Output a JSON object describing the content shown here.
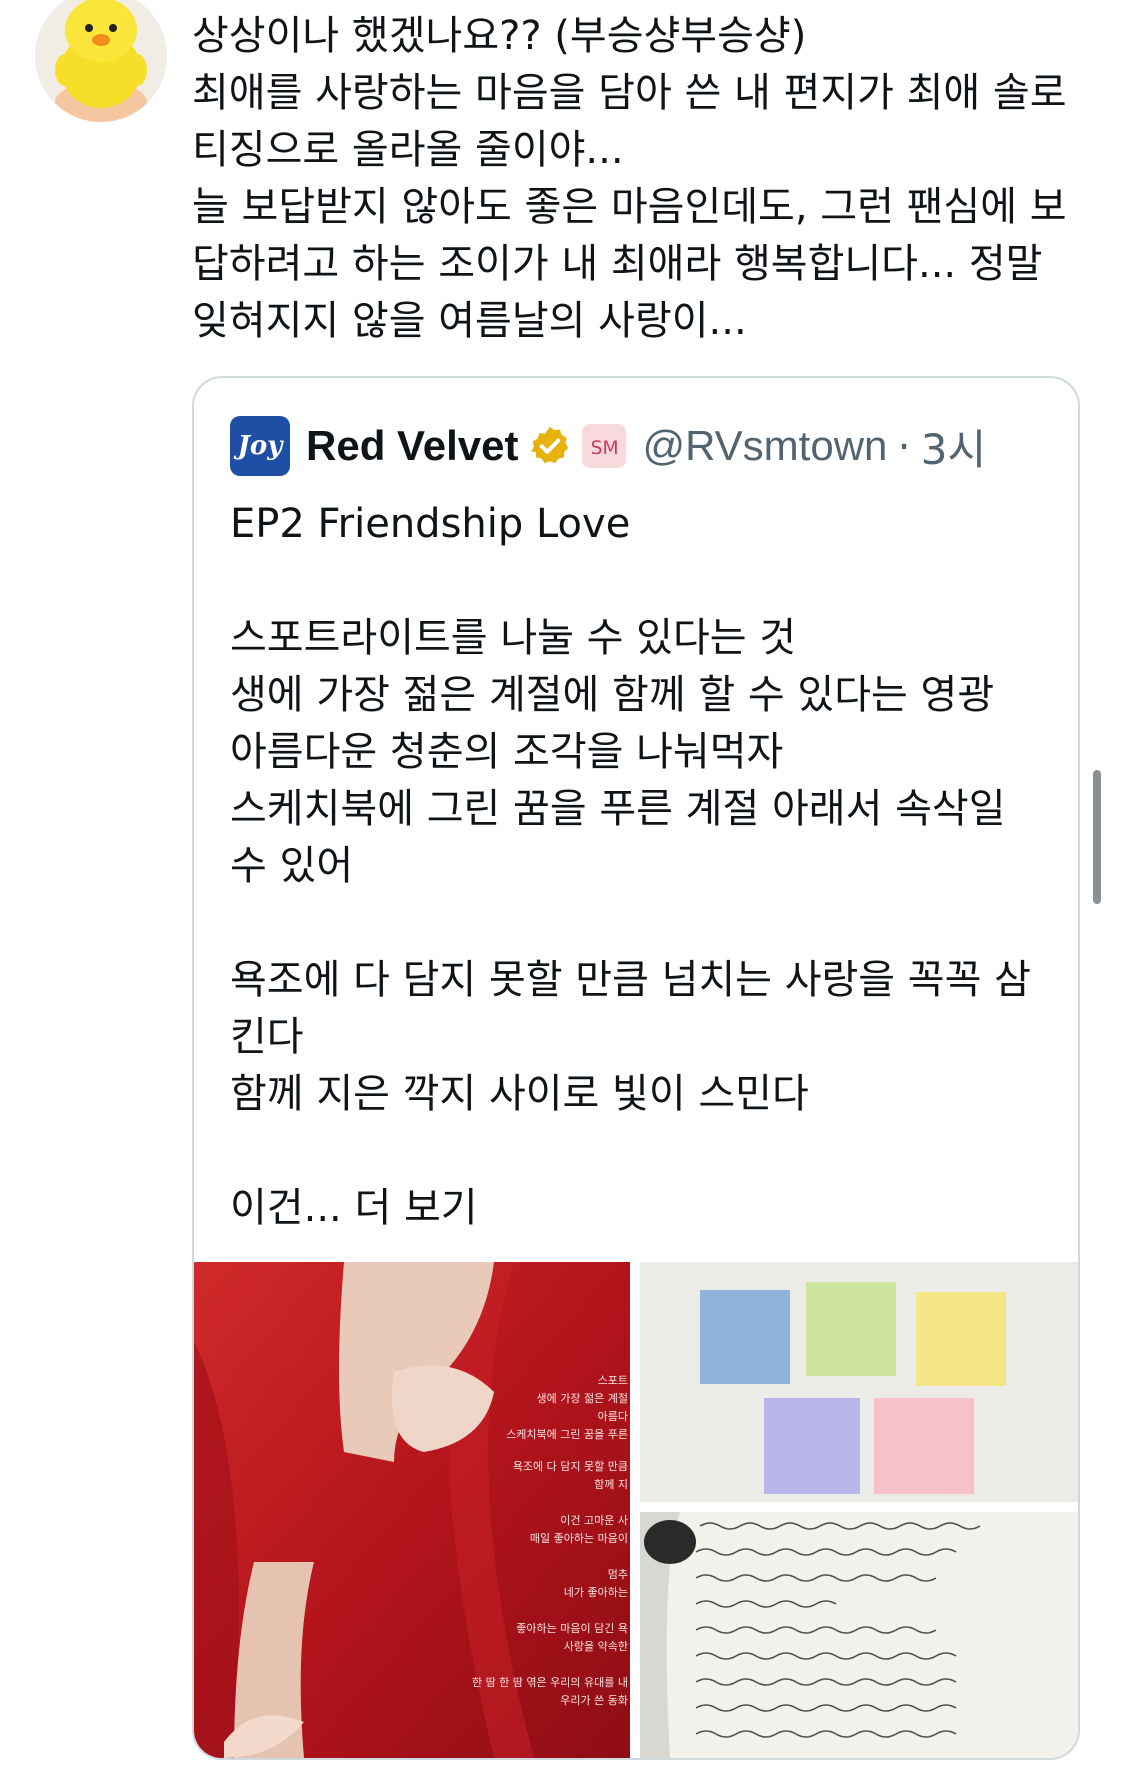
{
  "tweet": {
    "text": "상상이나 했겠나요?? (부승샹부승샹)\n최애를 사랑하는 마음을 담아 쓴 내 편지가 최애 솔로 티징으로 올라올 줄이야...\n늘 보답받지 않아도 좋은 마음인데도, 그런 팬심에 보답하려고 하는 조이가 내 최애라 행복합니다... 정말 잊혀지지 않을 여름날의 사랑이..."
  },
  "quote": {
    "avatar_text": "Joy",
    "name": "Red Velvet",
    "handle": "@RVsmtown",
    "dot": "·",
    "time": "3시",
    "body": "EP2 Friendship Love\n\n스포트라이트를 나눌 수 있다는 것\n생에 가장 젊은 계절에 함께 할 수 있다는 영광\n아름다운 청춘의 조각을 나눠먹자\n스케치북에 그린 꿈을 푸른 계절 아래서 속삭일 수 있어\n\n욕조에 다 담지 못할 만큼 넘치는 사랑을 꼭꼭 삼킨다\n함께 지은 깍지 사이로 빛이 스민다\n\n이건... 더 보기"
  },
  "media": {
    "poem_lines": [
      "스포트",
      "생에 가장 젊은 계절",
      "아름다",
      "스케치북에 그린 꿈을 푸른",
      "욕조에 다 담지 못할 만큼",
      "함께 지",
      "이건 고마운 사",
      "매일 좋아하는 마음이",
      "멈추",
      "네가 좋아하는",
      "좋아하는 마음이 담긴 욕",
      "사랑을 약속한",
      "한 땀 한 땀 엮은 우리의 유대를 내",
      "우리가 쓴 동화"
    ],
    "notes": [
      "#8fb3d9",
      "#cde59f",
      "#f4e587",
      "#b9b6ee",
      "#f6c2c7"
    ]
  },
  "colors": {
    "verified_gold": "#e8b20e",
    "joy_blue": "#1f4ea5",
    "dress_red": "#b8171e"
  }
}
